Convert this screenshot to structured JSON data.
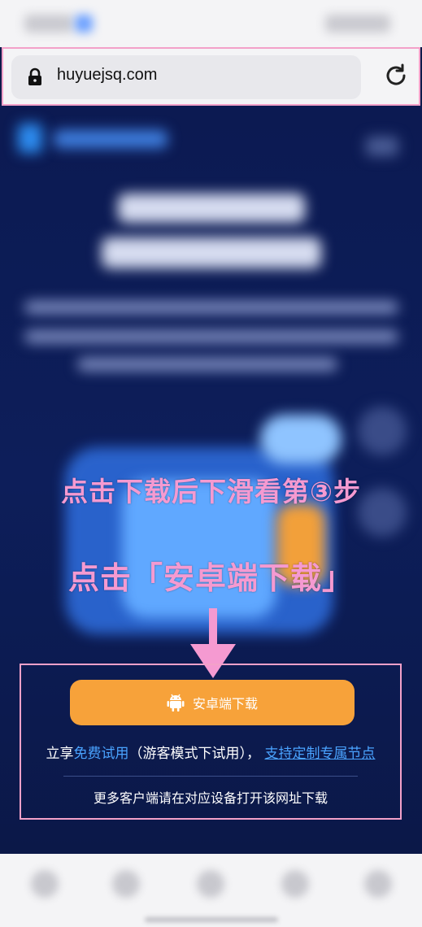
{
  "browser": {
    "url": "huyuejsq.com"
  },
  "annotations": {
    "hint_scroll": "点击下载后下滑看第③步",
    "hint_click": "点击「安卓端下载」"
  },
  "download": {
    "android_button_label": "安卓端下载",
    "trial_prefix": "立享",
    "trial_link": "免费试用",
    "trial_suffix": "（游客模式下试用），",
    "custom_link": "支持定制专属节点",
    "more_clients": "更多客户端请在对应设备打开该网址下载"
  },
  "colors": {
    "accent_orange": "#f7a23a",
    "annotation_pink": "#f59ad1",
    "link_blue": "#4aa3ff",
    "page_bg": "#0d1b4a"
  },
  "icons": {
    "lock": "lock-icon",
    "reload": "reload-icon",
    "android": "android-icon",
    "arrow": "arrow-down-icon"
  }
}
